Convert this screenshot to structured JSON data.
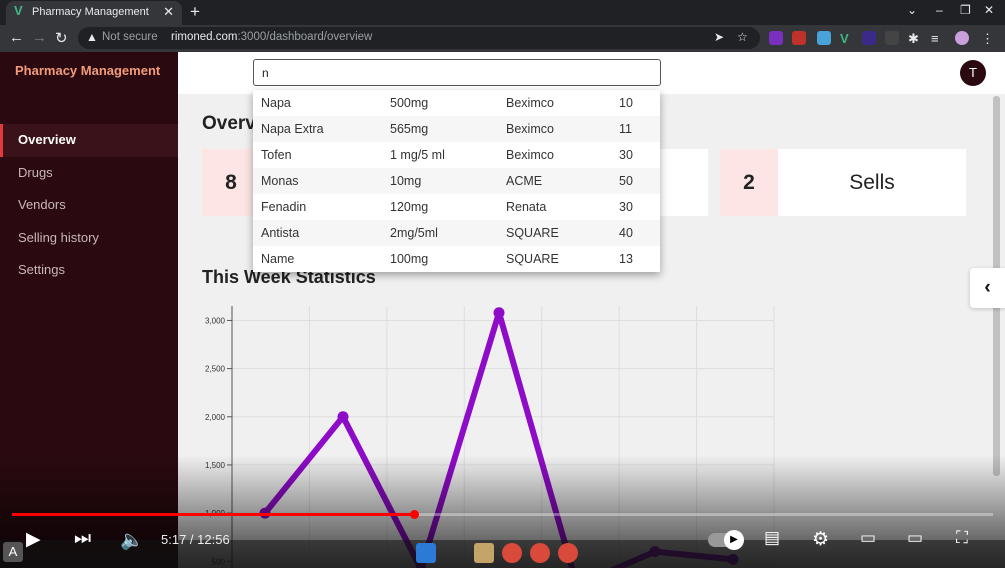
{
  "browser": {
    "tab_title": "Pharmacy Management",
    "new_tab": "+",
    "not_secure": "Not secure",
    "url_host": "rimoned.com",
    "url_path": ":3000/dashboard/overview"
  },
  "app": {
    "brand": "Pharmacy Management",
    "menu": [
      "Overview",
      "Drugs",
      "Vendors",
      "Selling history",
      "Settings"
    ],
    "search_value": "n",
    "avatar": "T",
    "overview_title": "Overview",
    "cards": [
      {
        "number": "8",
        "label": ""
      },
      {
        "number": "2",
        "label": "Sells"
      }
    ],
    "week_title": "This Week Statistics"
  },
  "dropdown_rows": [
    [
      "Napa",
      "500mg",
      "Beximco",
      "10"
    ],
    [
      "Napa Extra",
      "565mg",
      "Beximco",
      "11"
    ],
    [
      "Tofen",
      "1 mg/5 ml",
      "Beximco",
      "30"
    ],
    [
      "Monas",
      "10mg",
      "ACME",
      "50"
    ],
    [
      "Fenadin",
      "120mg",
      "Renata",
      "30"
    ],
    [
      "Antista",
      "2mg/5ml",
      "SQUARE",
      "40"
    ],
    [
      "Name",
      "100mg",
      "SQUARE",
      "13"
    ]
  ],
  "chart_data": {
    "type": "line",
    "x": [
      1,
      2,
      3,
      4,
      5,
      6,
      7
    ],
    "values": [
      1000,
      2000,
      420,
      3080,
      250,
      600,
      520
    ],
    "ylim": [
      430,
      3150
    ],
    "yticks": [
      "3,000",
      "2,500",
      "2,000",
      "1,500",
      "1,000",
      "500"
    ],
    "ytick_values": [
      3000,
      2500,
      2000,
      1500,
      1000,
      500
    ],
    "color": "#8e0bc7",
    "grid": true
  },
  "video": {
    "time": "5:17 / 12:56",
    "progress": 0.41
  }
}
